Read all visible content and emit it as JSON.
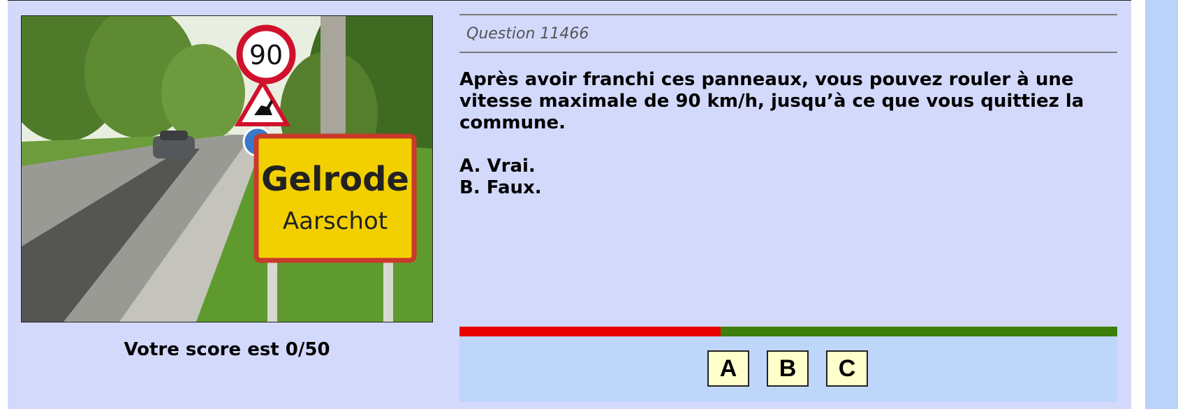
{
  "score": {
    "text": "Votre score est 0/50"
  },
  "question": {
    "number_label": "Question 11466",
    "text": "Après avoir franchi ces panneaux, vous pouvez rouler à une vitesse maximale de 90 km/h, jusqu’à ce que vous quittiez la commune.",
    "options": [
      "A. Vrai.",
      "B. Faux."
    ]
  },
  "photo": {
    "speed_sign": "90",
    "town_name": "Gelrode",
    "municipality": "Aarschot"
  },
  "timer": {
    "elapsed_fraction": 0.397
  },
  "answer_buttons": [
    "A",
    "B",
    "C"
  ],
  "colors": {
    "panel": "#d3d9fb",
    "answer_area": "#bfd6fb",
    "timer_elapsed": "#e60000",
    "timer_remaining": "#3d7f0a",
    "button_fill": "#ffffcc"
  }
}
